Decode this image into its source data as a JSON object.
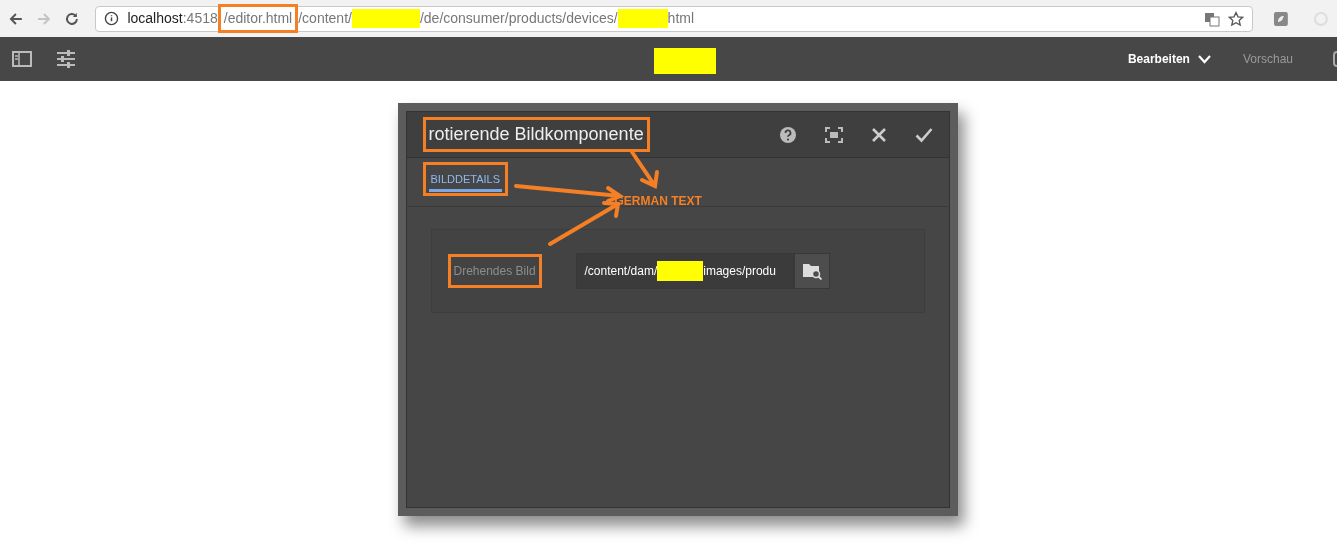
{
  "browser": {
    "url": [
      {
        "kind": "host",
        "text": "localhost"
      },
      {
        "kind": "text",
        "text": ":4518"
      },
      {
        "kind": "text",
        "text": "/editor.html",
        "annotated": true
      },
      {
        "kind": "text",
        "text": "/content/"
      },
      {
        "kind": "redacted"
      },
      {
        "kind": "text",
        "text": "/de/consumer/products/devices/"
      },
      {
        "kind": "redacted"
      },
      {
        "kind": "text",
        "text": "html"
      }
    ],
    "forward_disabled": true
  },
  "toolbar": {
    "modes": [
      {
        "label": "Bearbeiten",
        "selected": true
      },
      {
        "label": "Vorschau",
        "selected": false
      }
    ]
  },
  "dialog": {
    "title": "rotierende Bildkomponente",
    "title_annotated": true,
    "tabs": [
      {
        "label": "BILDDETAILS",
        "selected": true,
        "annotated": true
      }
    ],
    "annotation_note": "GERMAN TEXT",
    "fields": [
      {
        "label": "Drehendes Bild",
        "annotated": true,
        "value": [
          {
            "kind": "text",
            "text": "/content/dam/"
          },
          {
            "kind": "redacted"
          },
          {
            "kind": "text",
            "text": "images/produ"
          }
        ]
      }
    ]
  }
}
